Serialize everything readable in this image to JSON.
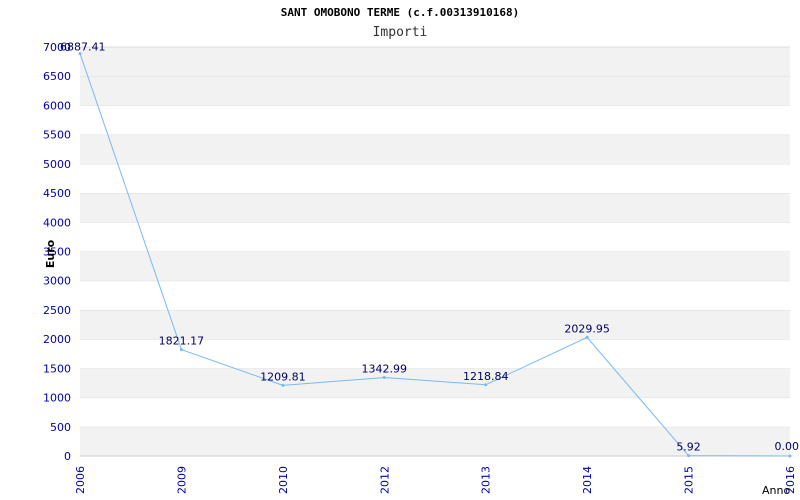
{
  "title": "SANT OMOBONO TERME (c.f.00313910168)",
  "subtitle": "Importi",
  "colors": {
    "line": "#7ab8f5",
    "band": "#f2f2f2",
    "tick": "#0000aa",
    "label": "#000066"
  },
  "chart_data": {
    "type": "line",
    "title": "SANT OMOBONO TERME (c.f.00313910168)",
    "subtitle": "Importi",
    "xlabel": "Anno",
    "ylabel": "Euro",
    "categories": [
      "2006",
      "2009",
      "2010",
      "2012",
      "2013",
      "2014",
      "2015",
      "2016"
    ],
    "series": [
      {
        "values": [
          6887.41,
          1821.17,
          1209.81,
          1342.99,
          1218.84,
          2029.95,
          5.92,
          0.0
        ]
      }
    ],
    "data_labels": [
      "6887.41",
      "1821.17",
      "1209.81",
      "1342.99",
      "1218.84",
      "2029.95",
      "5.92",
      "0.00"
    ],
    "ylim": [
      0,
      7000
    ],
    "yticks": [
      0,
      500,
      1000,
      1500,
      2000,
      2500,
      3000,
      3500,
      4000,
      4500,
      5000,
      5500,
      6000,
      6500,
      7000
    ],
    "grid": true,
    "legend": "none"
  }
}
